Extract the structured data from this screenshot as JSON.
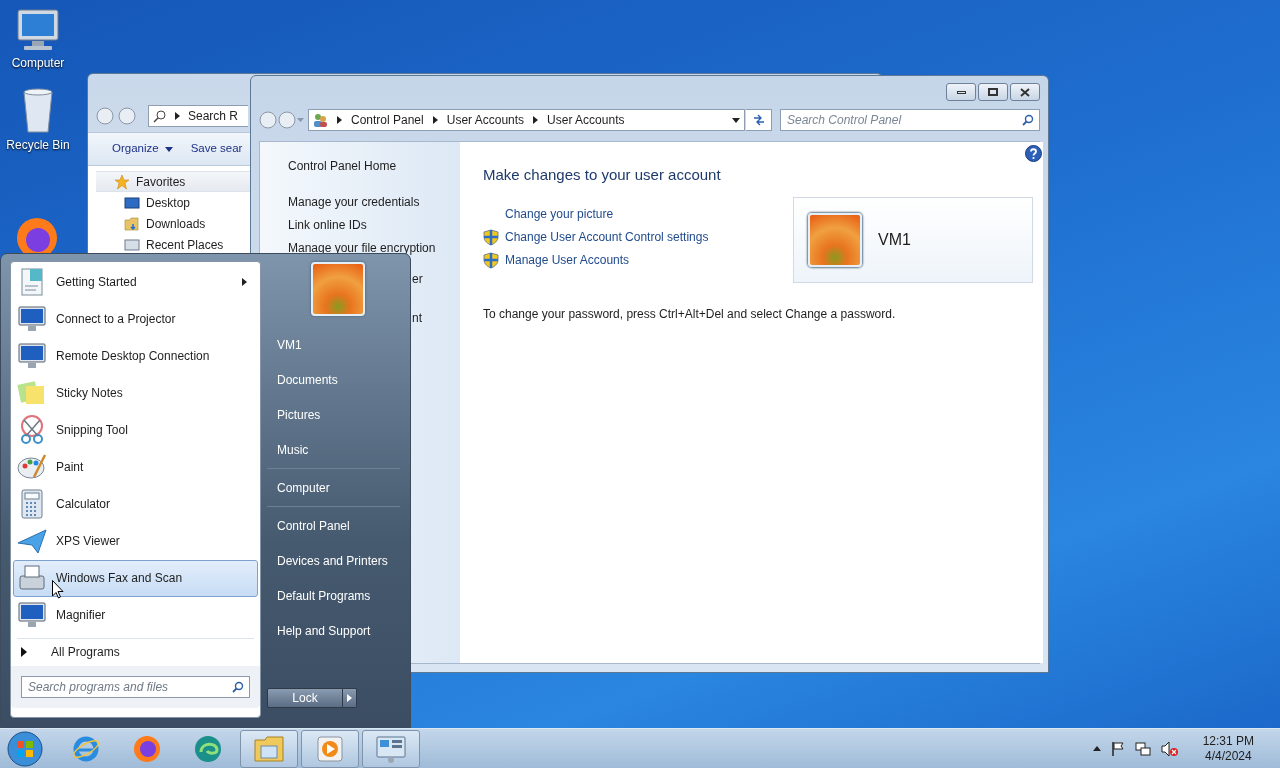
{
  "desktop_icons": [
    {
      "label": "Computer",
      "kind": "computer"
    },
    {
      "label": "Recycle Bin",
      "kind": "bin"
    }
  ],
  "explorer_window": {
    "search_path": "Search R",
    "toolbar": [
      {
        "label": "Organize",
        "dropdown": true
      },
      {
        "label": "Save sear",
        "dropdown": false
      }
    ],
    "nav": [
      {
        "label": "Favorites",
        "kind": "star",
        "selected": true
      },
      {
        "label": "Desktop",
        "kind": "desktop",
        "selected": false
      },
      {
        "label": "Downloads",
        "kind": "folder",
        "selected": false
      },
      {
        "label": "Recent Places",
        "kind": "recent",
        "selected": false
      }
    ]
  },
  "control_panel": {
    "breadcrumb": [
      "Control Panel",
      "User Accounts",
      "User Accounts"
    ],
    "search_placeholder": "Search Control Panel",
    "sidebar": [
      "Control Panel Home",
      "Manage your credentials",
      "Link online IDs",
      "Manage your file encryption"
    ],
    "sidebar_fragments": [
      "er",
      "nt"
    ],
    "heading": "Make changes to your user account",
    "links": [
      {
        "label": "Change your picture",
        "shield": false
      },
      {
        "label": "Change User Account Control settings",
        "shield": true
      },
      {
        "label": "Manage User Accounts",
        "shield": true
      }
    ],
    "user_name": "VM1",
    "note": "To change your password, press Ctrl+Alt+Del and select Change a password."
  },
  "start_menu": {
    "programs": [
      {
        "label": "Getting Started",
        "kind": "doc",
        "submenu": true,
        "selected": false
      },
      {
        "label": "Connect to a Projector",
        "kind": "monitor",
        "submenu": false,
        "selected": false
      },
      {
        "label": "Remote Desktop Connection",
        "kind": "monitor",
        "submenu": false,
        "selected": false
      },
      {
        "label": "Sticky Notes",
        "kind": "notes",
        "submenu": false,
        "selected": false
      },
      {
        "label": "Snipping Tool",
        "kind": "scissors",
        "submenu": false,
        "selected": false
      },
      {
        "label": "Paint",
        "kind": "palette",
        "submenu": false,
        "selected": false
      },
      {
        "label": "Calculator",
        "kind": "calc",
        "submenu": false,
        "selected": false
      },
      {
        "label": "XPS Viewer",
        "kind": "plane",
        "submenu": false,
        "selected": false
      },
      {
        "label": "Windows Fax and Scan",
        "kind": "fax",
        "submenu": false,
        "selected": true
      },
      {
        "label": "Magnifier",
        "kind": "monitor",
        "submenu": false,
        "selected": false
      }
    ],
    "all_programs": "All Programs",
    "search_placeholder": "Search programs and files",
    "places": [
      {
        "label": "VM1",
        "separator_before": false
      },
      {
        "label": "Documents",
        "separator_before": false
      },
      {
        "label": "Pictures",
        "separator_before": false
      },
      {
        "label": "Music",
        "separator_before": false
      },
      {
        "label": "Computer",
        "separator_before": true
      },
      {
        "label": "Control Panel",
        "separator_before": true
      },
      {
        "label": "Devices and Printers",
        "separator_before": false
      },
      {
        "label": "Default Programs",
        "separator_before": false
      },
      {
        "label": "Help and Support",
        "separator_before": false
      }
    ],
    "lock": "Lock"
  },
  "taskbar": {
    "apps": [
      {
        "kind": "ie",
        "open": false
      },
      {
        "kind": "firefox",
        "open": false
      },
      {
        "kind": "edge",
        "open": false
      },
      {
        "kind": "explorer",
        "open": true
      },
      {
        "kind": "media",
        "open": true
      },
      {
        "kind": "control",
        "open": true
      }
    ],
    "time": "12:31 PM",
    "date": "4/4/2024"
  }
}
